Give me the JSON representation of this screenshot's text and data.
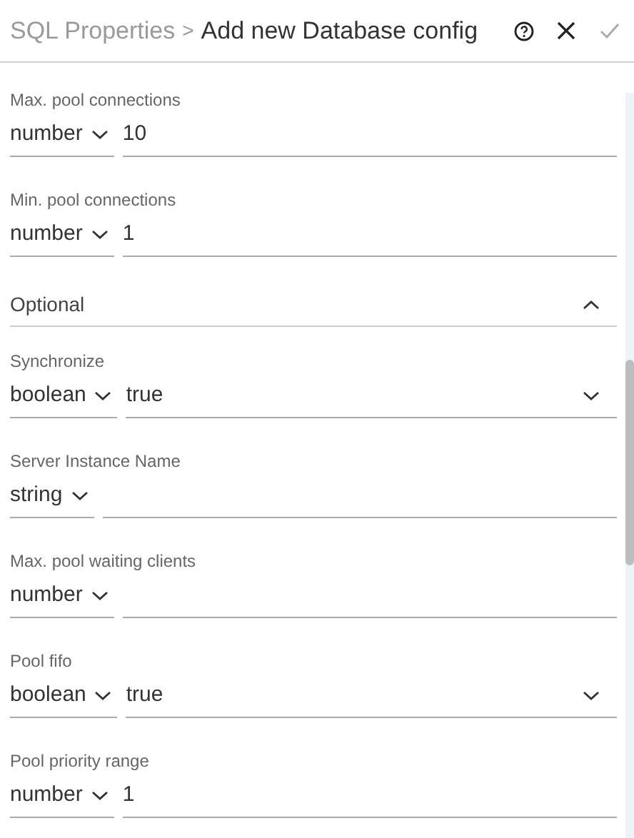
{
  "header": {
    "breadcrumb": "SQL Properties",
    "separator": ">",
    "title": "Add new Database config"
  },
  "fields": [
    {
      "kind": "text",
      "label": "Max. pool connections",
      "type": "number",
      "value": "10"
    },
    {
      "kind": "text",
      "label": "Min. pool connections",
      "type": "number",
      "value": "1"
    },
    {
      "kind": "section",
      "label": "Optional",
      "expanded": true
    },
    {
      "kind": "select",
      "label": "Synchronize",
      "type": "boolean",
      "value": "true"
    },
    {
      "kind": "text",
      "label": "Server Instance Name",
      "type": "string"
    },
    {
      "kind": "text",
      "label": "Max. pool waiting clients",
      "type": "number"
    },
    {
      "kind": "select",
      "label": "Pool fifo",
      "type": "boolean",
      "value": "true"
    },
    {
      "kind": "text",
      "label": "Pool priority range",
      "type": "number",
      "value": "1"
    }
  ]
}
